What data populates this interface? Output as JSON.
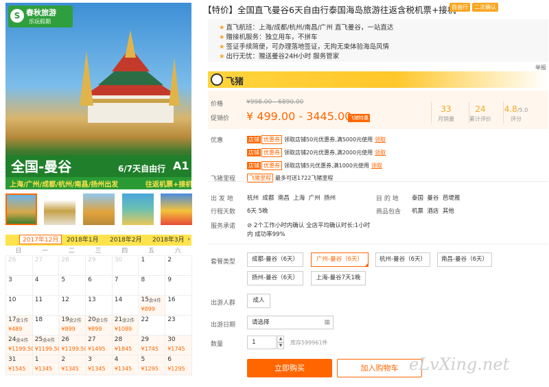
{
  "hero": {
    "logo_title": "春秋旅游",
    "logo_sub": "乐玩假期",
    "destination": "全国-曼谷",
    "days": "6/7天自由行",
    "code": "A1",
    "cities": "上海/广州/成都/杭州/南昌/扬州出发",
    "transport": "往返机票+接机"
  },
  "product": {
    "title": "【特价】全国直飞曼谷6天自由行泰国海岛旅游往返含税机票+接机",
    "tags": [
      "自由行",
      "二次确认"
    ],
    "features": [
      "直飞航班：上海/成都/杭州/南昌/广州 直飞曼谷，一站直达",
      "赠接机服务：独立用车，不拼车",
      "签证手续简便，可办理落地签证，无拘无束体验海岛风情",
      "出行无忧：赠送曼谷24H小时 服务管家"
    ],
    "report": "举报"
  },
  "shop": {
    "name": "飞猪"
  },
  "price": {
    "label_price": "价格",
    "original": "¥998.00 - 6890.00",
    "label_promo": "促销价",
    "promo": "¥ 499.00 - 3445.00",
    "promo_tag": "飞猪特惠",
    "stats": [
      {
        "value": "33",
        "label": "月销量"
      },
      {
        "value": "24",
        "label": "累计评价"
      },
      {
        "value": "4.8",
        "suffix": "/5.0",
        "label": "评分"
      }
    ]
  },
  "coupons": {
    "label": "优惠",
    "badge1": "店铺",
    "badge2": "优惠券",
    "get": "领取",
    "items": [
      "领取店铺50元优惠券,满5000元使用",
      "领取店铺20元优惠券,满2000元使用",
      "领取店铺5元优惠券,满1000元使用"
    ]
  },
  "mileage": {
    "label": "飞猪里程",
    "badge": "飞猪里程",
    "text": "最多可送1722飞猪里程"
  },
  "info": {
    "depart_label": "出 发 地",
    "depart": [
      "杭州",
      "成都",
      "南昌",
      "上海",
      "广州",
      "扬州"
    ],
    "dest_label": "目 的 地",
    "dest": [
      "泰国",
      "曼谷",
      "芭堤雅"
    ],
    "days_label": "行程天数",
    "days": "6天  5晚",
    "include_label": "商品包含",
    "include": [
      "机票",
      "酒店",
      "其他"
    ],
    "service_label": "服务承诺",
    "service_line1": "2个工作小时内确认 全店平均确认时长:1小时",
    "service_line2": "内 成功率99%"
  },
  "options": {
    "label": "套餐类型",
    "items": [
      "成都-曼谷（6天）",
      "广州-曼谷（6天）",
      "杭州-曼谷（6天）",
      "南昌-曼谷（6天）",
      "扬州-曼谷（6天）",
      "上海-曼谷7天1晚"
    ],
    "selected_index": 1
  },
  "people": {
    "label": "出游人群",
    "value": "成人"
  },
  "date": {
    "label": "出游日期",
    "placeholder": "请选择"
  },
  "quantity": {
    "label": "数量",
    "value": "1",
    "stock": "库存599961件"
  },
  "buttons": {
    "buy": "立即购买",
    "cart": "加入购物车"
  },
  "watermark": "eLvXing.net",
  "calendar": {
    "months": [
      "2017年12月",
      "2018年1月",
      "2018年2月",
      "2018年3月"
    ],
    "selected_month": 0,
    "weekdays": [
      "日",
      "一",
      "二",
      "三",
      "四",
      "五",
      "六"
    ],
    "rows": [
      [
        {
          "d": "26",
          "g": 1
        },
        {
          "d": "27",
          "g": 1
        },
        {
          "d": "28",
          "g": 1
        },
        {
          "d": "29",
          "g": 1
        },
        {
          "d": "30",
          "g": 1
        },
        {
          "d": "1"
        },
        {
          "d": "2"
        }
      ],
      [
        {
          "d": "3"
        },
        {
          "d": "4"
        },
        {
          "d": "5"
        },
        {
          "d": "6"
        },
        {
          "d": "7"
        },
        {
          "d": "8"
        },
        {
          "d": "9"
        }
      ],
      [
        {
          "d": "10"
        },
        {
          "d": "11"
        },
        {
          "d": "12"
        },
        {
          "d": "13"
        },
        {
          "d": "14"
        },
        {
          "d": "15",
          "s": "余4件",
          "p": "¥899"
        },
        {
          "d": "16"
        }
      ],
      [
        {
          "d": "17",
          "s": "余1件",
          "p": "¥489"
        },
        {
          "d": "18"
        },
        {
          "d": "19",
          "s": "余2件",
          "p": "¥899"
        },
        {
          "d": "20",
          "s": "余1件",
          "p": "¥899"
        },
        {
          "d": "21",
          "s": "余2件",
          "p": "¥1089"
        },
        {
          "d": "22"
        },
        {
          "d": "23"
        }
      ],
      [
        {
          "d": "24",
          "s": "余4件",
          "p": "¥1199.50"
        },
        {
          "d": "25",
          "s": "余4件",
          "p": "¥1199.50"
        },
        {
          "d": "26",
          "p": "¥1199.50"
        },
        {
          "d": "27",
          "p": "¥1495"
        },
        {
          "d": "28",
          "p": "¥1845"
        },
        {
          "d": "29",
          "p": "¥1745"
        },
        {
          "d": "30",
          "p": "¥1745"
        }
      ],
      [
        {
          "d": "31",
          "p": "¥1545"
        },
        {
          "d": "1",
          "p": "¥1345"
        },
        {
          "d": "2",
          "p": "¥1345"
        },
        {
          "d": "3",
          "p": "¥1345"
        },
        {
          "d": "4",
          "p": "¥1345"
        },
        {
          "d": "5",
          "p": "¥1295"
        },
        {
          "d": "6",
          "p": "¥1295"
        }
      ]
    ]
  }
}
